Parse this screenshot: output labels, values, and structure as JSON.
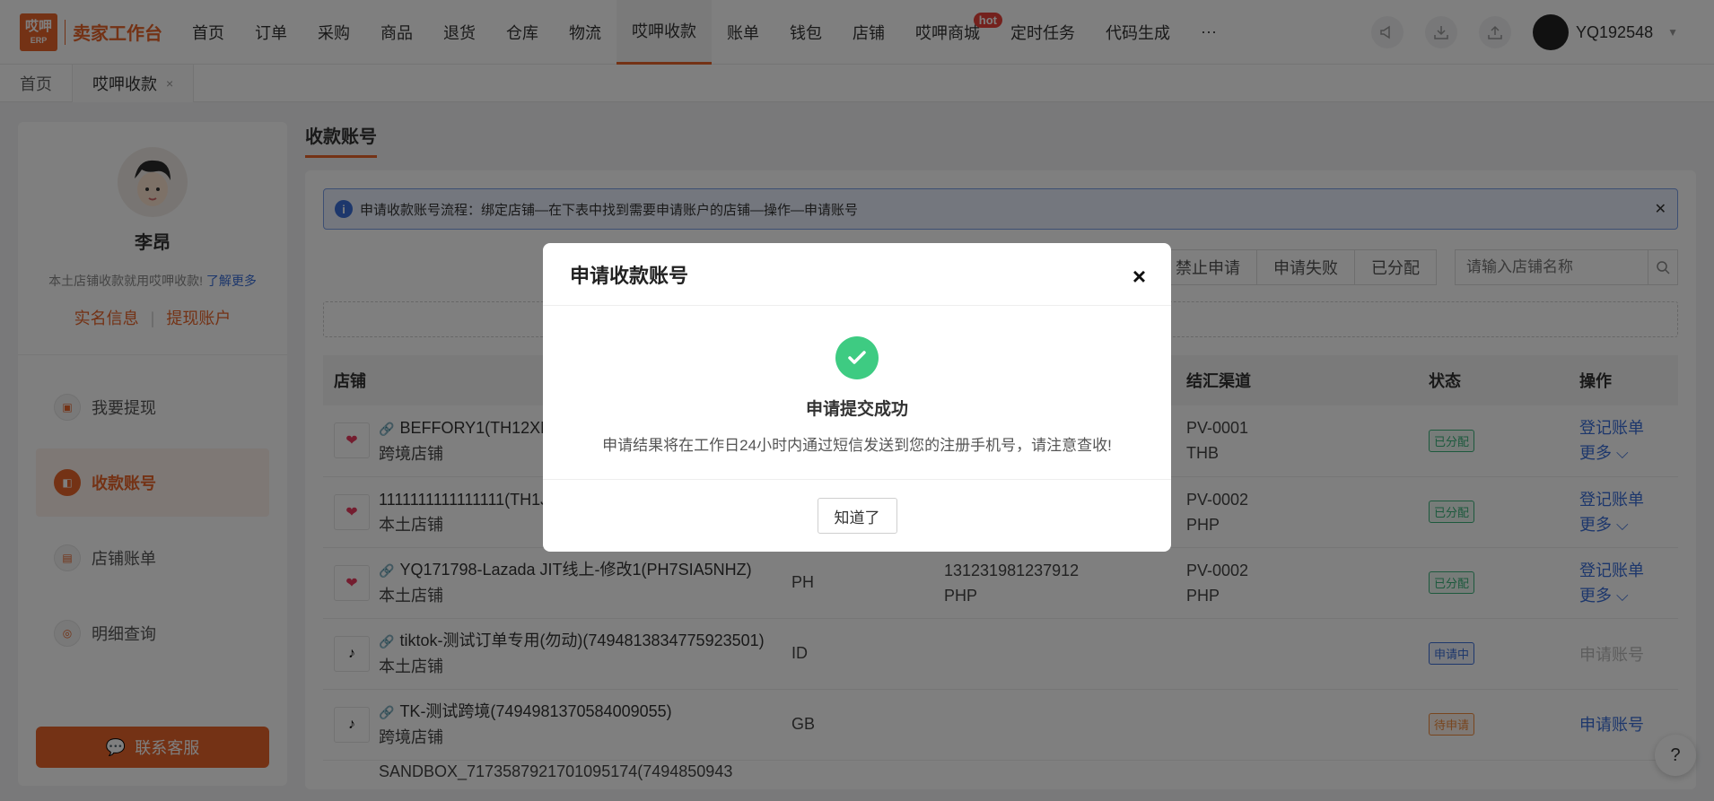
{
  "brand": {
    "logo_top": "哎呷",
    "logo_bottom": "ERP",
    "title": "卖家工作台"
  },
  "nav": {
    "items": [
      "首页",
      "订单",
      "采购",
      "商品",
      "退货",
      "仓库",
      "物流",
      "哎呷收款",
      "账单",
      "钱包",
      "店铺",
      "哎呷商城",
      "定时任务",
      "代码生成",
      "···"
    ],
    "active_index": 7,
    "hot_label": "hot",
    "username": "YQ192548"
  },
  "tabs": {
    "home": "首页",
    "current": "哎呷收款",
    "close": "×"
  },
  "sidebar": {
    "name": "李昂",
    "tip": "本土店铺收款就用哎呷收款!",
    "tip_link": "了解更多",
    "link_realname": "实名信息",
    "link_divider": "|",
    "link_withdraw_account": "提现账户",
    "menu": [
      {
        "label": "我要提现",
        "icon": "wallet-icon"
      },
      {
        "label": "收款账号",
        "icon": "receipt-icon"
      },
      {
        "label": "店铺账单",
        "icon": "bill-icon"
      },
      {
        "label": "明细查询",
        "icon": "search-doc-icon"
      }
    ],
    "active_menu": 1,
    "contact": "联系客服"
  },
  "main": {
    "title": "收款账号",
    "alert": "申请收款账号流程：绑定店铺—在下表中找到需要申请账户的店铺—操作—申请账号",
    "filters": [
      "禁止申请",
      "申请失败",
      "已分配"
    ],
    "search_placeholder": "请输入店铺名称",
    "table": {
      "headers": {
        "store": "店铺",
        "channel": "结汇渠道",
        "status": "状态",
        "ops": "操作"
      },
      "rows": [
        {
          "logo": "lazada",
          "name": "BEFFORY1(TH12XL",
          "type": "跨境店铺",
          "site": "",
          "account": "",
          "currency": "",
          "channel": "PV-0001",
          "channel_cur": "THB",
          "status": "已分配",
          "status_color": "green",
          "op1": "登记账单",
          "op2": "更多 ⌵"
        },
        {
          "logo": "lazada",
          "name": "1111111111111111(TH1J",
          "type": "本土店铺",
          "site": "",
          "account": "",
          "currency": "",
          "channel": "PV-0002",
          "channel_cur": "PHP",
          "status": "已分配",
          "status_color": "green",
          "op1": "登记账单",
          "op2": "更多 ⌵"
        },
        {
          "logo": "lazada",
          "name": "YQ171798-Lazada JIT线上-修改1(PH7SIA5NHZ)",
          "type": "本土店铺",
          "site": "PH",
          "account": "131231981237912",
          "currency": "PHP",
          "channel": "PV-0002",
          "channel_cur": "PHP",
          "status": "已分配",
          "status_color": "green",
          "op1": "登记账单",
          "op2": "更多 ⌵"
        },
        {
          "logo": "tiktok",
          "name": "tiktok-测试订单专用(勿动)(7494813834775923501)",
          "type": "本土店铺",
          "site": "ID",
          "account": "",
          "currency": "",
          "channel": "",
          "channel_cur": "",
          "status": "申请中",
          "status_color": "blue",
          "op1": "申请账号",
          "op2": "",
          "op_disabled": true
        },
        {
          "logo": "tiktok",
          "name": "TK-测试跨境(7494981370584009055)",
          "type": "跨境店铺",
          "site": "GB",
          "account": "",
          "currency": "",
          "channel": "",
          "channel_cur": "",
          "status": "待申请",
          "status_color": "orange",
          "op1": "申请账号",
          "op2": ""
        }
      ],
      "partial_row": "SANDBOX_7173587921701095174(7494850943"
    },
    "help": "?"
  },
  "modal": {
    "title": "申请收款账号",
    "close": "×",
    "success_title": "申请提交成功",
    "success_msg": "申请结果将在工作日24小时内通过短信发送到您的注册手机号，请注意查收!",
    "ok": "知道了"
  },
  "colors": {
    "accent": "#e8652b",
    "link": "#3a6ed8",
    "success": "#3ecb82"
  }
}
